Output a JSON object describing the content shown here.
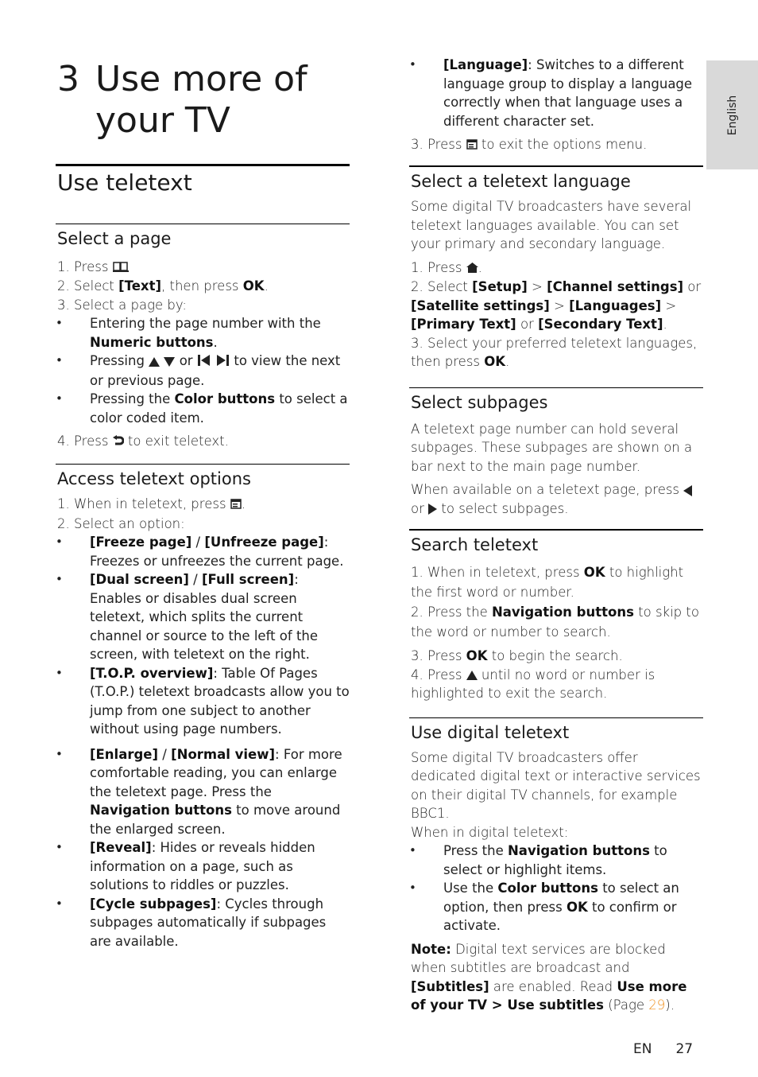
{
  "chapter": {
    "number": "3",
    "title": "Use more of your TV"
  },
  "side_tab": "English",
  "footer": {
    "lang": "EN",
    "page": "27"
  },
  "left": {
    "section_title": "Use teletext",
    "select_page": {
      "heading": "Select a page",
      "step1": "1. Press",
      "step2_pre": "2. Select ",
      "step2_b1": "[Text]",
      "step2_mid": ", then press ",
      "step2_b2": "OK",
      "step2_end": ".",
      "step3": "3. Select a page by:",
      "b1_pre": "Entering the page number with the ",
      "b1_b": "Numeric buttons",
      "b1_end": ".",
      "b2_pre": "Pressing",
      "b2_or": "or",
      "b2_end": "to view the next or previous page.",
      "b3_pre": "Pressing the ",
      "b3_b": "Color buttons",
      "b3_end": " to select a color coded item.",
      "step4_pre": "4. Press",
      "step4_end": "to exit teletext."
    },
    "options": {
      "heading": "Access teletext options",
      "step1": "1. When in teletext, press",
      "step2": "2. Select an option:",
      "items": [
        {
          "b1": "[Freeze page]",
          "sep": " / ",
          "b2": "[Unfreeze page]",
          "text": ": Freezes or unfreezes the current page."
        },
        {
          "b1": "[Dual screen]",
          "sep": " / ",
          "b2": "[Full screen]",
          "text": ": Enables or disables dual screen teletext, which splits the current channel or source to the left of the screen, with teletext on the right."
        },
        {
          "b1": "[T.O.P. overview]",
          "text": ": Table Of Pages (T.O.P.) teletext broadcasts allow you to jump from one subject to another without using page numbers."
        },
        {
          "b1": "[Enlarge]",
          "sep": " / ",
          "b2": "[Normal view]",
          "text": ": For more comfortable reading, you can enlarge the teletext page. Press the ",
          "b3": "Navigation buttons",
          "text2": " to move around the enlarged screen."
        },
        {
          "b1": "[Reveal]",
          "text": ": Hides or reveals hidden information on a page, such as solutions to riddles or puzzles."
        },
        {
          "b1": "[Cycle subpages]",
          "text": ": Cycles through subpages automatically if subpages are available."
        }
      ]
    }
  },
  "right": {
    "lang_item": {
      "b": "[Language]",
      "text": ": Switches to a different language group to display a language correctly when that language uses a different character set."
    },
    "step3_pre": "3. Press",
    "step3_end": "to exit the options menu.",
    "teletext_lang": {
      "heading": "Select a teletext language",
      "intro": "Some digital TV broadcasters have several teletext languages available. You can set your primary and secondary language.",
      "step1": "1. Press",
      "step2_pre": "2. Select ",
      "s_setup": "[Setup]",
      "gt": " > ",
      "s_channel": "[Channel settings]",
      "or": " or ",
      "s_sat": "[Satellite settings]",
      "s_lang": "[Languages]",
      "s_primary": "[Primary Text]",
      "s_secondary": "[Secondary Text]",
      "step3_pre": "3. Select your preferred teletext languages, then press ",
      "ok": "OK"
    },
    "subpages": {
      "heading": "Select subpages",
      "p1": "A teletext page number can hold several subpages. These subpages are shown on a bar next to the main page number.",
      "p2_pre": "When available on a teletext page, press",
      "p2_or": "or",
      "p2_end": "to select subpages."
    },
    "search": {
      "heading": "Search teletext",
      "s1_pre": "1. When in teletext, press ",
      "s1_b": "OK",
      "s1_end": " to highlight the first word or number.",
      "s2_pre": "2. Press the ",
      "s2_b": "Navigation buttons",
      "s2_end": " to skip to the word or number to search.",
      "s3_pre": "3. Press ",
      "s3_b": "OK",
      "s3_end": " to begin the search.",
      "s4_pre": "4. Press",
      "s4_end": "until no word or number is highlighted to exit the search."
    },
    "digital": {
      "heading": "Use digital teletext",
      "p1": "Some digital TV broadcasters offer dedicated digital text or interactive services on their digital TV channels, for example BBC1.",
      "p2": "When in digital teletext:",
      "b1_pre": "Press the ",
      "b1_b": "Navigation buttons",
      "b1_end": "  to select or highlight items.",
      "b2_pre": "Use the ",
      "b2_b": "Color buttons",
      "b2_mid": " to select an option, then press ",
      "b2_b2": "OK",
      "b2_end": " to confirm or activate.",
      "note_label": "Note:",
      "note_text": " Digital text services are blocked when subtitles are broadcast and ",
      "note_b": "[Subtitles]",
      "note_text2": " are enabled. Read ",
      "note_link_b": "Use more of your TV > Use subtitles",
      "note_pre_page": " (Page ",
      "note_page": "29",
      "note_end": ")."
    }
  },
  "colors": {
    "link": "#f0901e",
    "tab_bg": "#d9d9d9"
  }
}
